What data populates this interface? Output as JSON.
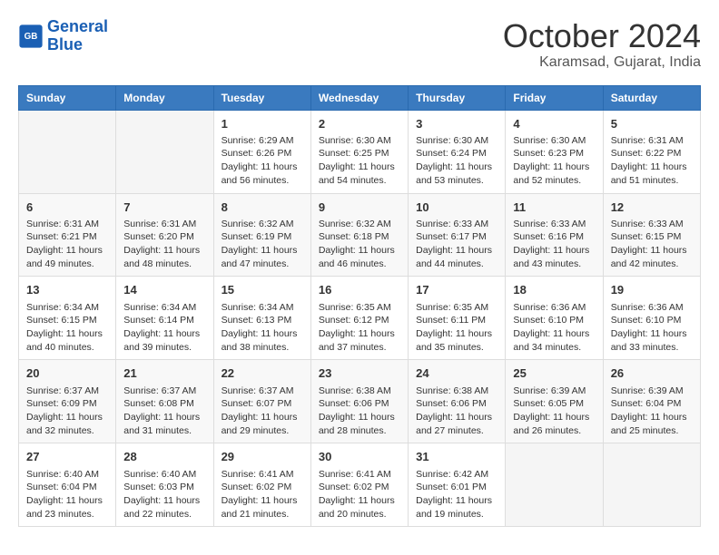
{
  "logo": {
    "line1": "General",
    "line2": "Blue"
  },
  "title": "October 2024",
  "location": "Karamsad, Gujarat, India",
  "weekdays": [
    "Sunday",
    "Monday",
    "Tuesday",
    "Wednesday",
    "Thursday",
    "Friday",
    "Saturday"
  ],
  "weeks": [
    [
      null,
      null,
      {
        "day": "1",
        "sunrise": "Sunrise: 6:29 AM",
        "sunset": "Sunset: 6:26 PM",
        "daylight": "Daylight: 11 hours and 56 minutes."
      },
      {
        "day": "2",
        "sunrise": "Sunrise: 6:30 AM",
        "sunset": "Sunset: 6:25 PM",
        "daylight": "Daylight: 11 hours and 54 minutes."
      },
      {
        "day": "3",
        "sunrise": "Sunrise: 6:30 AM",
        "sunset": "Sunset: 6:24 PM",
        "daylight": "Daylight: 11 hours and 53 minutes."
      },
      {
        "day": "4",
        "sunrise": "Sunrise: 6:30 AM",
        "sunset": "Sunset: 6:23 PM",
        "daylight": "Daylight: 11 hours and 52 minutes."
      },
      {
        "day": "5",
        "sunrise": "Sunrise: 6:31 AM",
        "sunset": "Sunset: 6:22 PM",
        "daylight": "Daylight: 11 hours and 51 minutes."
      }
    ],
    [
      {
        "day": "6",
        "sunrise": "Sunrise: 6:31 AM",
        "sunset": "Sunset: 6:21 PM",
        "daylight": "Daylight: 11 hours and 49 minutes."
      },
      {
        "day": "7",
        "sunrise": "Sunrise: 6:31 AM",
        "sunset": "Sunset: 6:20 PM",
        "daylight": "Daylight: 11 hours and 48 minutes."
      },
      {
        "day": "8",
        "sunrise": "Sunrise: 6:32 AM",
        "sunset": "Sunset: 6:19 PM",
        "daylight": "Daylight: 11 hours and 47 minutes."
      },
      {
        "day": "9",
        "sunrise": "Sunrise: 6:32 AM",
        "sunset": "Sunset: 6:18 PM",
        "daylight": "Daylight: 11 hours and 46 minutes."
      },
      {
        "day": "10",
        "sunrise": "Sunrise: 6:33 AM",
        "sunset": "Sunset: 6:17 PM",
        "daylight": "Daylight: 11 hours and 44 minutes."
      },
      {
        "day": "11",
        "sunrise": "Sunrise: 6:33 AM",
        "sunset": "Sunset: 6:16 PM",
        "daylight": "Daylight: 11 hours and 43 minutes."
      },
      {
        "day": "12",
        "sunrise": "Sunrise: 6:33 AM",
        "sunset": "Sunset: 6:15 PM",
        "daylight": "Daylight: 11 hours and 42 minutes."
      }
    ],
    [
      {
        "day": "13",
        "sunrise": "Sunrise: 6:34 AM",
        "sunset": "Sunset: 6:15 PM",
        "daylight": "Daylight: 11 hours and 40 minutes."
      },
      {
        "day": "14",
        "sunrise": "Sunrise: 6:34 AM",
        "sunset": "Sunset: 6:14 PM",
        "daylight": "Daylight: 11 hours and 39 minutes."
      },
      {
        "day": "15",
        "sunrise": "Sunrise: 6:34 AM",
        "sunset": "Sunset: 6:13 PM",
        "daylight": "Daylight: 11 hours and 38 minutes."
      },
      {
        "day": "16",
        "sunrise": "Sunrise: 6:35 AM",
        "sunset": "Sunset: 6:12 PM",
        "daylight": "Daylight: 11 hours and 37 minutes."
      },
      {
        "day": "17",
        "sunrise": "Sunrise: 6:35 AM",
        "sunset": "Sunset: 6:11 PM",
        "daylight": "Daylight: 11 hours and 35 minutes."
      },
      {
        "day": "18",
        "sunrise": "Sunrise: 6:36 AM",
        "sunset": "Sunset: 6:10 PM",
        "daylight": "Daylight: 11 hours and 34 minutes."
      },
      {
        "day": "19",
        "sunrise": "Sunrise: 6:36 AM",
        "sunset": "Sunset: 6:10 PM",
        "daylight": "Daylight: 11 hours and 33 minutes."
      }
    ],
    [
      {
        "day": "20",
        "sunrise": "Sunrise: 6:37 AM",
        "sunset": "Sunset: 6:09 PM",
        "daylight": "Daylight: 11 hours and 32 minutes."
      },
      {
        "day": "21",
        "sunrise": "Sunrise: 6:37 AM",
        "sunset": "Sunset: 6:08 PM",
        "daylight": "Daylight: 11 hours and 31 minutes."
      },
      {
        "day": "22",
        "sunrise": "Sunrise: 6:37 AM",
        "sunset": "Sunset: 6:07 PM",
        "daylight": "Daylight: 11 hours and 29 minutes."
      },
      {
        "day": "23",
        "sunrise": "Sunrise: 6:38 AM",
        "sunset": "Sunset: 6:06 PM",
        "daylight": "Daylight: 11 hours and 28 minutes."
      },
      {
        "day": "24",
        "sunrise": "Sunrise: 6:38 AM",
        "sunset": "Sunset: 6:06 PM",
        "daylight": "Daylight: 11 hours and 27 minutes."
      },
      {
        "day": "25",
        "sunrise": "Sunrise: 6:39 AM",
        "sunset": "Sunset: 6:05 PM",
        "daylight": "Daylight: 11 hours and 26 minutes."
      },
      {
        "day": "26",
        "sunrise": "Sunrise: 6:39 AM",
        "sunset": "Sunset: 6:04 PM",
        "daylight": "Daylight: 11 hours and 25 minutes."
      }
    ],
    [
      {
        "day": "27",
        "sunrise": "Sunrise: 6:40 AM",
        "sunset": "Sunset: 6:04 PM",
        "daylight": "Daylight: 11 hours and 23 minutes."
      },
      {
        "day": "28",
        "sunrise": "Sunrise: 6:40 AM",
        "sunset": "Sunset: 6:03 PM",
        "daylight": "Daylight: 11 hours and 22 minutes."
      },
      {
        "day": "29",
        "sunrise": "Sunrise: 6:41 AM",
        "sunset": "Sunset: 6:02 PM",
        "daylight": "Daylight: 11 hours and 21 minutes."
      },
      {
        "day": "30",
        "sunrise": "Sunrise: 6:41 AM",
        "sunset": "Sunset: 6:02 PM",
        "daylight": "Daylight: 11 hours and 20 minutes."
      },
      {
        "day": "31",
        "sunrise": "Sunrise: 6:42 AM",
        "sunset": "Sunset: 6:01 PM",
        "daylight": "Daylight: 11 hours and 19 minutes."
      },
      null,
      null
    ]
  ]
}
